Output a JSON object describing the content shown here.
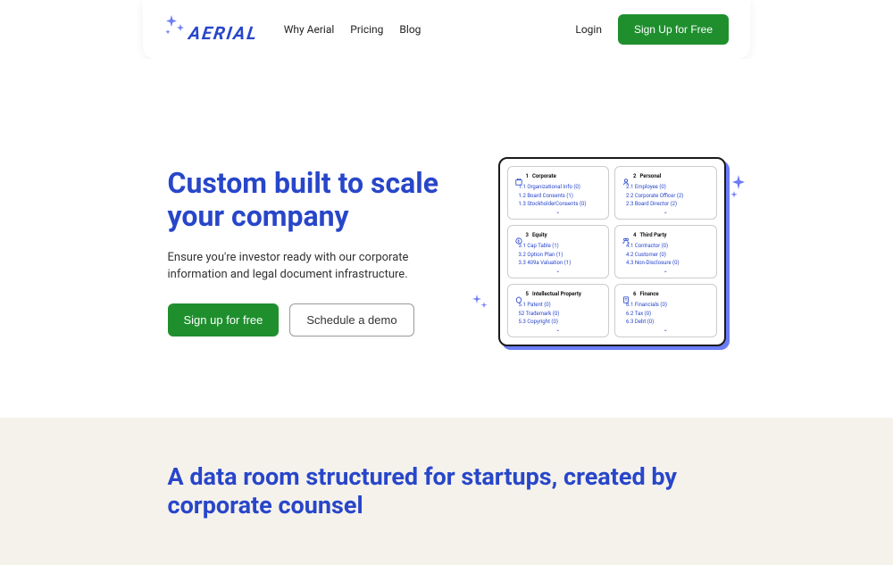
{
  "brand": "AERIAL",
  "nav": {
    "why": "Why Aerial",
    "pricing": "Pricing",
    "blog": "Blog"
  },
  "header": {
    "login": "Login",
    "signup": "Sign Up for Free"
  },
  "hero": {
    "title": "Custom built to scale your company",
    "subtitle": "Ensure you're investor ready with our corporate information and legal document infrastructure.",
    "cta_primary": "Sign up for free",
    "cta_secondary": "Schedule a demo"
  },
  "cards": [
    {
      "num": "1",
      "title": "Corporate",
      "items": [
        "1.1  Organizational Info (0)",
        "1.2  Board Consents (1)",
        "1.3  StockholderConsents (0)"
      ]
    },
    {
      "num": "2",
      "title": "Personal",
      "items": [
        "2.1  Employee (0)",
        "2.2  Corporate Officer (2)",
        "2.3  Board Director (2)"
      ]
    },
    {
      "num": "3",
      "title": "Equity",
      "items": [
        "3.1  Cap Table (1)",
        "3.2  Option Plan (1)",
        "3.3  409a Valuation (1)"
      ]
    },
    {
      "num": "4",
      "title": "Third Party",
      "items": [
        "4.1  Contractor (0)",
        "4.2  Customer (0)",
        "4.3  Non-Disclosure (0)"
      ]
    },
    {
      "num": "5",
      "title": "Intellectual Property",
      "items": [
        "5.1  Patent (0)",
        "52  Trademark (0)",
        "5.3  Copyright (0)"
      ]
    },
    {
      "num": "6",
      "title": "Finance",
      "items": [
        "6.1  Financials (0)",
        "6.2  Tax (0)",
        "6.3  Debt (0)"
      ]
    }
  ],
  "section2": {
    "title": "A data room structured for startups, created by corporate counsel"
  }
}
